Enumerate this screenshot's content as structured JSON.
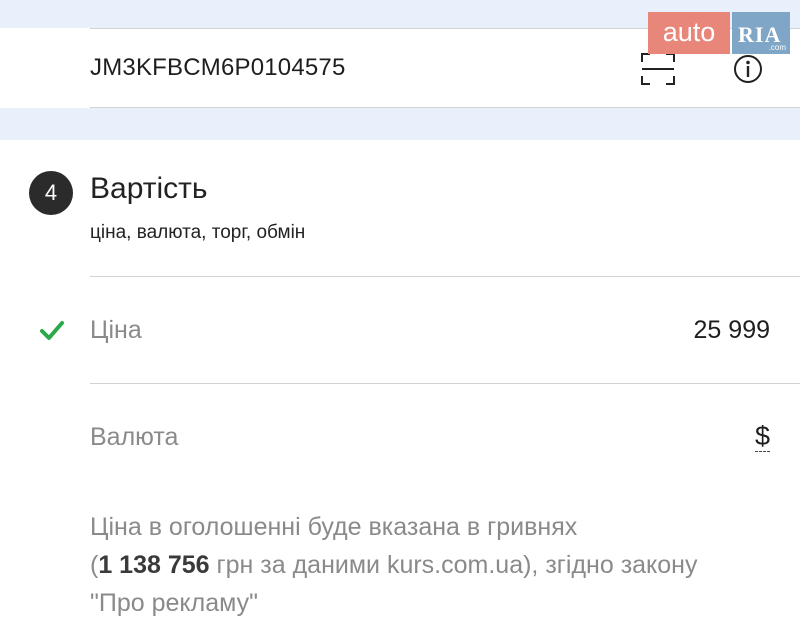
{
  "vin": {
    "value": "JM3KFBCM6P0104575"
  },
  "icons": {
    "scan": "scan-icon",
    "info": "info-icon",
    "check": "check-icon"
  },
  "logo": {
    "auto": "auto",
    "ria": "RIA",
    "com": ".com"
  },
  "section": {
    "step": "4",
    "title": "Вартість",
    "subtitle": "ціна, валюта, торг, обмін"
  },
  "price": {
    "label": "Ціна",
    "value": "25 999"
  },
  "currency": {
    "label": "Валюта",
    "value": "$"
  },
  "note": {
    "line1": "Ціна в оголошенні буде вказана в гривнях",
    "open": "(",
    "amount": "1 138 756",
    "rest": " грн за даними kurs.com.ua), згідно закону",
    "line3": "\"Про рекламу\""
  },
  "colors": {
    "band": "#e8f1fb",
    "check": "#2aa84a",
    "logo_auto": "#e8867a",
    "logo_ria": "#7fa6c7",
    "badge": "#2b2b2b"
  }
}
